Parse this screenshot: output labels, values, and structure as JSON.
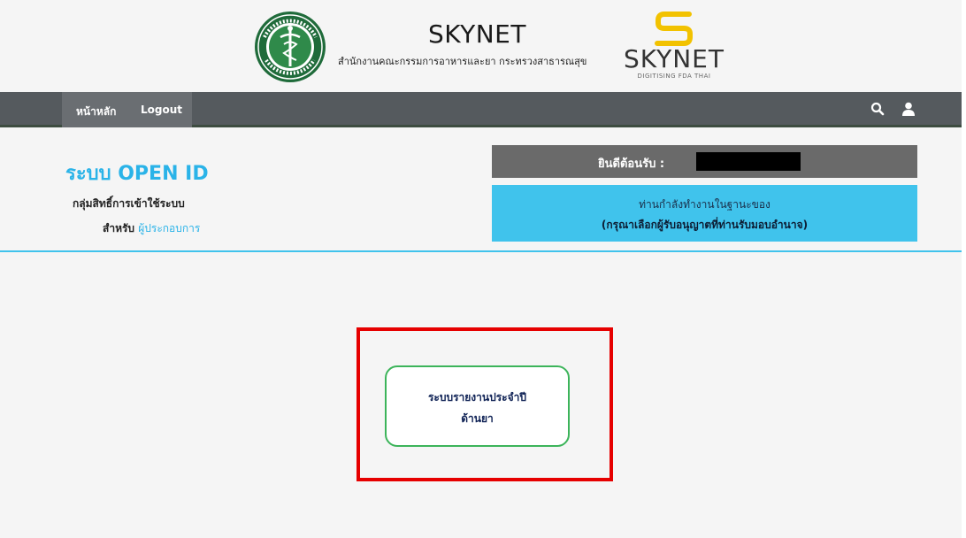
{
  "header": {
    "app_title": "SKYNET",
    "subtitle": "สำนักงานคณะกรรมการอาหารและยา กระทรวงสาธารณสุข",
    "logo_word": "SKYNET",
    "logo_tagline": "DIGITISING FDA THAI",
    "moph_logo_icon": "ministry-of-public-health-seal",
    "skynet_logo_icon": "skynet-s-logo",
    "brand_color": "#f2c200"
  },
  "nav": {
    "home_label": "หน้าหลัก",
    "logout_label": "Logout",
    "search_icon": "search-icon",
    "user_icon": "user-icon"
  },
  "info": {
    "system_title": "ระบบ OPEN ID",
    "group_label": "กลุ่มสิทธิ์การเข้าใช้ระบบ",
    "for_prefix": "สำหรับ",
    "for_value": "ผู้ประกอบการ",
    "accent_color": "#2ab3e8"
  },
  "welcome": {
    "label": "ยินดีต้อนรับ :",
    "user_name_redacted": true
  },
  "role": {
    "line1": "ท่านกำลังทำงานในฐานะของ",
    "line2": "(กรุณาเลือกผู้รับอนุญาตที่ท่านรับมอบอำนาจ)"
  },
  "menu": {
    "annual_report_line1": "ระบบรายงานประจำปี",
    "annual_report_line2": "ด้านยา",
    "highlight_color": "#e60000",
    "card_border_color": "#3cb45a"
  }
}
